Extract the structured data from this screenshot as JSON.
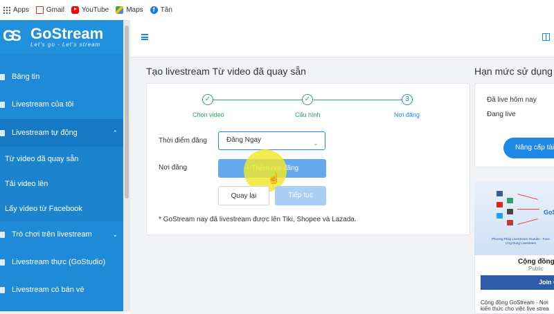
{
  "bookmarks": [
    {
      "label": "Apps",
      "icon": "apps-grid-icon"
    },
    {
      "label": "Gmail",
      "icon": "gmail-icon"
    },
    {
      "label": "YouTube",
      "icon": "youtube-icon"
    },
    {
      "label": "Maps",
      "icon": "maps-icon"
    },
    {
      "label": "Tân",
      "icon": "facebook-icon"
    }
  ],
  "brand": {
    "name": "GoStream",
    "mark": "GS",
    "slogan": "Let's go - Let's stream"
  },
  "sidebar": {
    "items": [
      {
        "label": "Bảng tin"
      },
      {
        "label": "Livestream của tôi"
      },
      {
        "label": "Livestream tự động",
        "chevron": "⌃"
      },
      {
        "label": "Từ video đã quay sẵn"
      },
      {
        "label": "Tải video lên"
      },
      {
        "label": "Lấy video từ Facebook"
      },
      {
        "label": "Trò chơi trên livestream",
        "chevron": "⌄"
      },
      {
        "label": "Livestream thực (GoStudio)"
      },
      {
        "label": "Livestream có bán vé"
      }
    ]
  },
  "main": {
    "title": "Tạo livestream Từ video đã quay sẵn",
    "steps": [
      {
        "label": "Chọn video",
        "symbol": "✓",
        "state": "done"
      },
      {
        "label": "Cấu hình",
        "symbol": "✓",
        "state": "done"
      },
      {
        "label": "Nơi đăng",
        "symbol": "3",
        "state": "current"
      }
    ],
    "form": {
      "time_label": "Thời điểm đăng",
      "time_value": "Đăng Ngay",
      "place_label": "Nơi đăng",
      "add_place_button": "+ Thêm nơi đăng"
    },
    "buttons": {
      "back": "Quay lại",
      "next": "Tiếp tục"
    },
    "note": "* GoStream nay đã livestream được lên Tiki, Shopee và Lazada."
  },
  "quota": {
    "title": "Hạn mức sử dụng",
    "live_today": "Đã live hôm nay",
    "live_now": "Đang live",
    "upgrade_button": "Nâng cấp tài"
  },
  "facebook_card": {
    "banner_brand": "GoS",
    "banner_caption_1": "Phương Pháp LiveStream Youtube - Face",
    "banner_caption_2": "Ứng Dụng Livestream",
    "name": "Cộng đồng",
    "visibility": "Public",
    "join_button": "Join G",
    "desc_1": "Cộng đồng GoStream - Nơi",
    "desc_2": "kiến thức cho việc live strea"
  },
  "colors": {
    "brand_blue": "#1f8ad8",
    "accent": "#1e88e5",
    "success": "#2ba36a",
    "highlight": "#f0e828"
  }
}
